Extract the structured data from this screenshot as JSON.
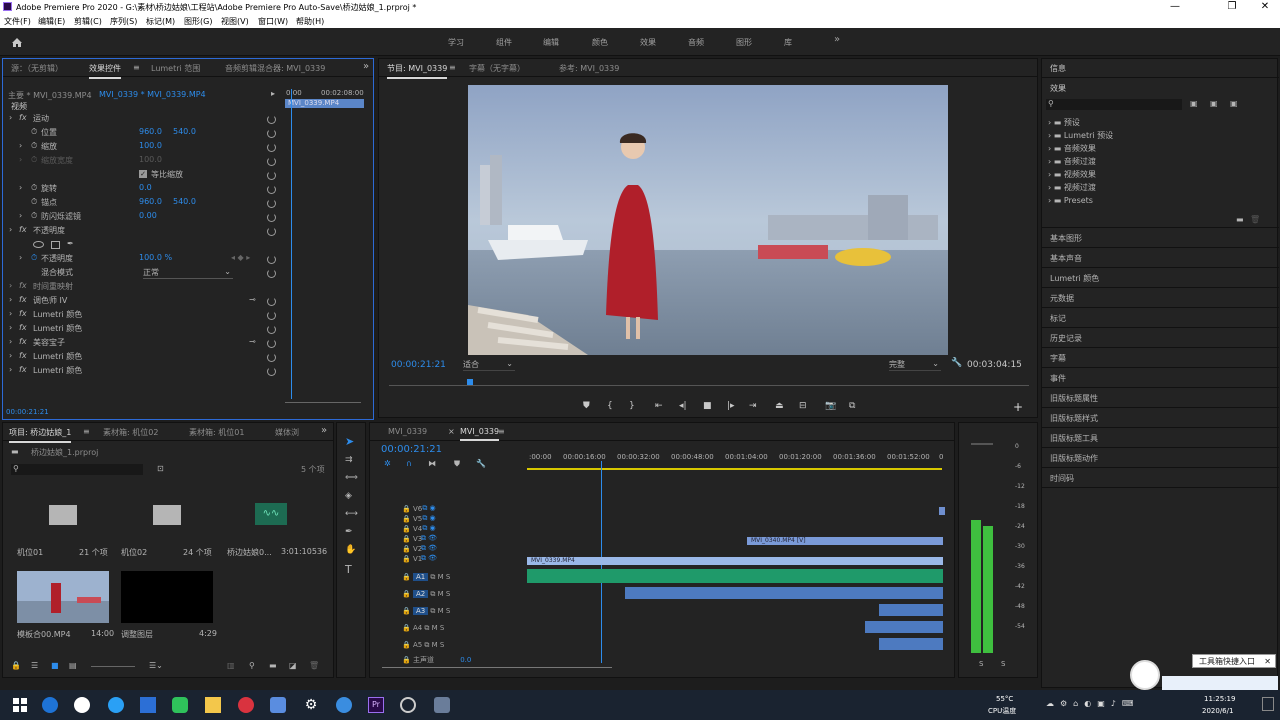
{
  "titlebar": {
    "title": "Adobe Premiere Pro 2020 - G:\\素材\\桥边姑娘\\工程站\\Adobe Premiere Pro Auto-Save\\桥边姑娘_1.prproj *",
    "minimize": "—",
    "maximize": "❐",
    "close": "✕"
  },
  "menu": [
    "文件(F)",
    "编辑(E)",
    "剪辑(C)",
    "序列(S)",
    "标记(M)",
    "图形(G)",
    "视图(V)",
    "窗口(W)",
    "帮助(H)"
  ],
  "workspaces": [
    "学习",
    "组件",
    "编辑",
    "颜色",
    "效果",
    "音频",
    "图形",
    "库"
  ],
  "workspace_more": "»",
  "effect_controls": {
    "tabs": [
      "源：（无剪辑）",
      "效果控件",
      "Lumetri 范围",
      "音频剪辑混合器: MVI_0339"
    ],
    "master": "主要 * MVI_0339.MP4",
    "clip": "MVI_0339 * MVI_0339.MP4",
    "time_start": "0:00",
    "time_end": "00:02:08:00",
    "clip_bar": "MVI_0339.MP4",
    "section_video": "视频",
    "motion": "运动",
    "position_label": "位置",
    "position_x": "960.0",
    "position_y": "540.0",
    "scale_label": "缩放",
    "scale_val": "100.0",
    "scale_w_label": "缩放宽度",
    "scale_w_val": "100.0",
    "uniform_label": "等比缩放",
    "rotation_label": "旋转",
    "rotation_val": "0.0",
    "anchor_label": "锚点",
    "anchor_x": "960.0",
    "anchor_y": "540.0",
    "flicker_label": "防闪烁滤镜",
    "flicker_val": "0.00",
    "opacity": "不透明度",
    "opacity_label": "不透明度",
    "opacity_val": "100.0 %",
    "blend_label": "混合模式",
    "blend_val": "正常",
    "time_remap": "时间重映射",
    "fx_items": [
      "调色师 IV",
      "Lumetri 颜色",
      "Lumetri 颜色",
      "美容宝子",
      "Lumetri 颜色",
      "Lumetri 颜色"
    ],
    "timecode": "00:00:21:21"
  },
  "program": {
    "tabs": [
      "节目: MVI_0339",
      "字幕（无字幕）",
      "参考: MVI_0339"
    ],
    "timecode": "00:00:21:21",
    "fit": "适合",
    "quality": "完整",
    "duration": "00:03:04:15"
  },
  "right_panel": {
    "info": "信息",
    "effects": "效果",
    "folders": [
      "预设",
      "Lumetri 预设",
      "音频效果",
      "音频过渡",
      "视频效果",
      "视频过渡",
      "Presets"
    ],
    "sections": [
      "基本图形",
      "基本声音",
      "Lumetri 颜色",
      "元数据",
      "标记",
      "历史记录",
      "字幕",
      "事件",
      "旧版标题属性",
      "旧版标题样式",
      "旧版标题工具",
      "旧版标题动作",
      "时间码"
    ]
  },
  "project": {
    "tabs": [
      "项目: 桥边姑娘_1",
      "素材箱: 机位02",
      "素材箱: 机位01",
      "媒体浏"
    ],
    "file": "桥边姑娘_1.prproj",
    "count": "5 个项",
    "items": [
      {
        "name": "机位01",
        "info": "21 个项"
      },
      {
        "name": "机位02",
        "info": "24 个项"
      },
      {
        "name": "桥边姑娘0...",
        "info": "3:01:10536"
      },
      {
        "name": "模板合00.MP4",
        "info": "14:00"
      },
      {
        "name": "调整图层",
        "info": "4:29"
      }
    ]
  },
  "timeline": {
    "tabs": [
      "MVI_0339",
      "MVI_0339"
    ],
    "timecode": "00:00:21:21",
    "ruler": [
      ":00:00",
      "00:00:16:00",
      "00:00:32:00",
      "00:00:48:00",
      "00:01:04:00",
      "00:01:20:00",
      "00:01:36:00",
      "00:01:52:00",
      "0"
    ],
    "video_tracks": [
      "V6",
      "V5",
      "V4",
      "V3",
      "V2",
      "V1"
    ],
    "audio_tracks": [
      "A1",
      "A2",
      "A3",
      "A4",
      "A5"
    ],
    "mix_label": "主声道",
    "mix_val": "0.0",
    "clip_v3": "MVI_0340.MP4 [V]",
    "clip_v1": "MVI_0339.MP4"
  },
  "meter": {
    "scale": [
      "0",
      "-6",
      "-12",
      "-18",
      "-24",
      "-30",
      "-36",
      "-42",
      "-48",
      "-54"
    ],
    "solo": [
      "S",
      "S"
    ],
    "level_left": 0.68,
    "level_right": 0.65
  },
  "tooltip": "工具箱快捷入口",
  "taskbar": {
    "temp": "55°C",
    "temp_label": "CPU温度",
    "time": "11:25:19",
    "date": "2020/6/1"
  }
}
